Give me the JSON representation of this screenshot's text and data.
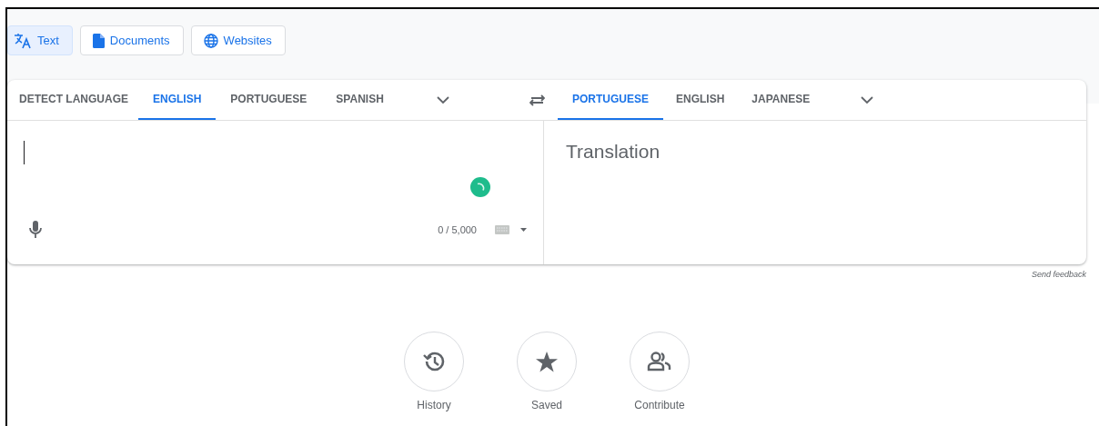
{
  "modes": [
    {
      "label": "Text",
      "selected": true
    },
    {
      "label": "Documents",
      "selected": false
    },
    {
      "label": "Websites",
      "selected": false
    }
  ],
  "source_languages": [
    {
      "label": "DETECT LANGUAGE",
      "selected": false
    },
    {
      "label": "ENGLISH",
      "selected": true
    },
    {
      "label": "PORTUGUESE",
      "selected": false
    },
    {
      "label": "SPANISH",
      "selected": false
    }
  ],
  "target_languages": [
    {
      "label": "PORTUGUESE",
      "selected": true
    },
    {
      "label": "ENGLISH",
      "selected": false
    },
    {
      "label": "JAPANESE",
      "selected": false
    }
  ],
  "source": {
    "char_count": "0 / 5,000"
  },
  "target": {
    "placeholder": "Translation"
  },
  "feedback_link": "Send feedback",
  "shortcuts": [
    {
      "label": "History"
    },
    {
      "label": "Saved"
    },
    {
      "label": "Contribute"
    }
  ]
}
